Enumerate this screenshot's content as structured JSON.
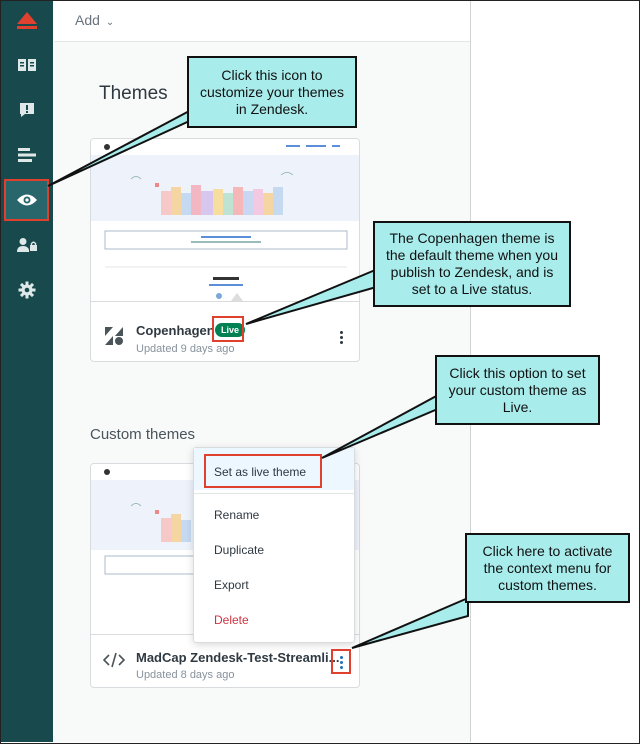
{
  "topbar": {
    "add_label": "Add"
  },
  "sections": {
    "themes_title": "Themes",
    "custom_title": "Custom themes"
  },
  "themes": [
    {
      "name": "Copenhagen",
      "badge": "Live",
      "updated": "Updated 9 days ago",
      "logo_icon": "zendesk-logo-icon"
    }
  ],
  "custom_themes": [
    {
      "name": "MadCap Zendesk-Test-Streamli...",
      "updated": "Updated 8 days ago",
      "logo_icon": "code-icon"
    }
  ],
  "context_menu": {
    "items": [
      "Set as live theme",
      "Rename",
      "Duplicate",
      "Export",
      "Delete"
    ]
  },
  "sidebar": {
    "icons": [
      "zendesk-logo-icon",
      "guide-book-icon",
      "alert-icon",
      "arrange-content-icon",
      "eye-icon",
      "user-permissions-icon",
      "settings-gear-icon"
    ]
  },
  "callouts": [
    "Click this icon to customize your themes in Zendesk.",
    "The Copenhagen theme is the default theme when you publish to Zendesk, and is set to a Live status.",
    "Click this option to set your custom theme as Live.",
    "Click here to activate the context menu for custom themes."
  ],
  "colors": {
    "sidebar": "#17494d",
    "callout": "#a9ecec",
    "highlight": "#e0412e",
    "live_badge": "#038153",
    "delete": "#cc3340"
  }
}
